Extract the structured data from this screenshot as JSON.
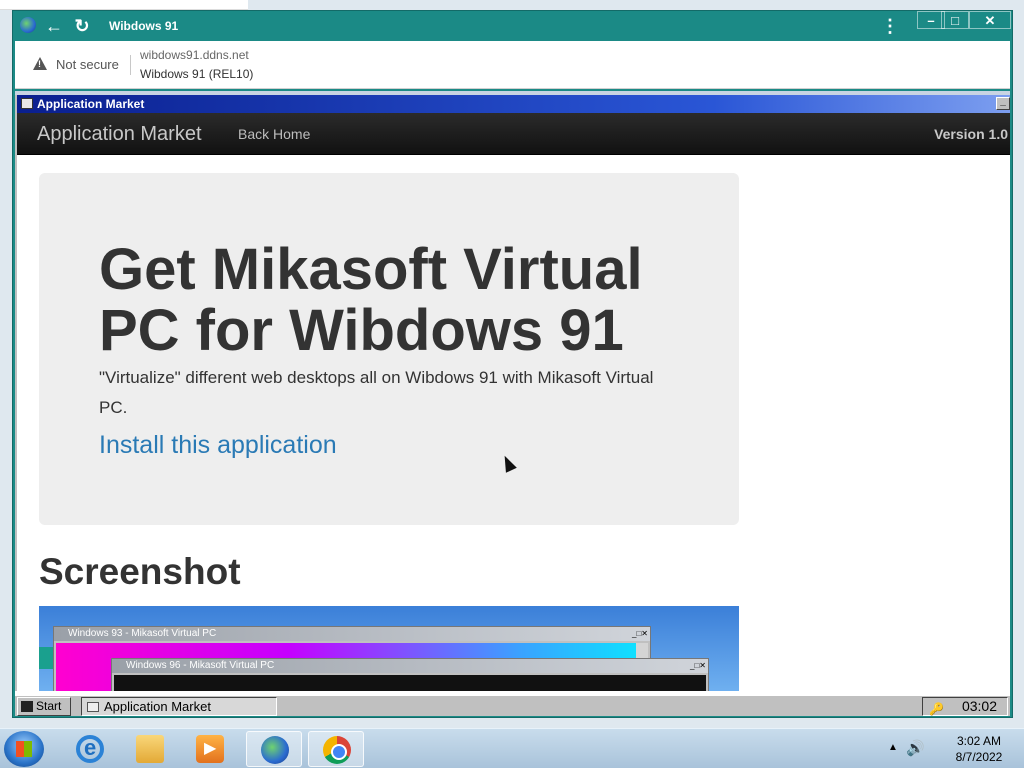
{
  "browser": {
    "window_title": "Wibdows 91",
    "security_label": "Not secure",
    "url": "wibdows91.ddns.net",
    "page_title": "Wibdows 91 (REL10)",
    "back_icon": "←",
    "reload_icon": "↻",
    "menu_icon": "⋮",
    "min_icon": "–",
    "max_icon": "□",
    "close_icon": "✕"
  },
  "app_window": {
    "title": "Application Market",
    "min_icon": "_"
  },
  "navbar": {
    "brand": "Application Market",
    "back_home": "Back Home",
    "version": "Version 1.0"
  },
  "hero": {
    "heading": "Get Mikasoft Virtual PC for Wibdows 91",
    "description": "\"Virtualize\" different web desktops all on Wibdows 91 with Mikasoft Virtual PC.",
    "install_link": "Install this application"
  },
  "screenshot_section": {
    "heading": "Screenshot",
    "window1_title": "Windows 93 - Mikasoft Virtual PC",
    "window2_title": "Windows 96 - Mikasoft Virtual PC",
    "window_buttons": "_□✕"
  },
  "w91_taskbar": {
    "start_label": "Start",
    "task_label": "Application Market",
    "clock": "03:02"
  },
  "win7_taskbar": {
    "pinned": [
      "internet-explorer",
      "windows-explorer",
      "media-player",
      "wibdows-globe",
      "chrome"
    ],
    "time": "3:02 AM",
    "date": "8/7/2022",
    "tray_arrow": "▲",
    "volume_icon": "🔊"
  }
}
